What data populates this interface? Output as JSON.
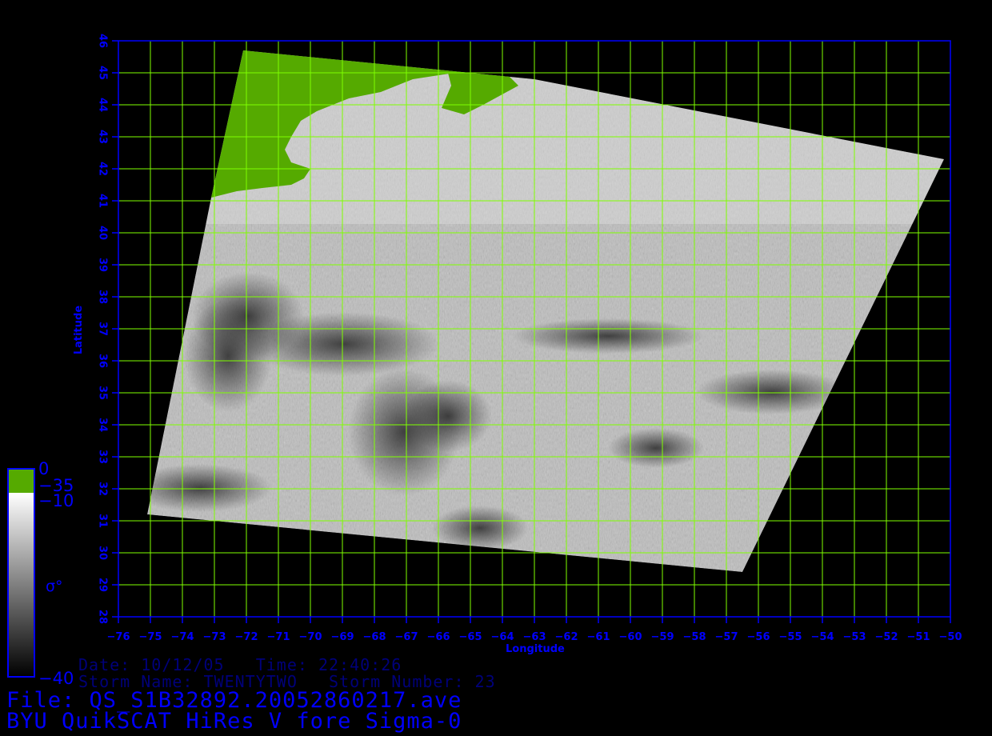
{
  "map": {
    "lon_min": -76,
    "lon_max": -50,
    "lon_step": 1,
    "lat_min": 28,
    "lat_max": 46,
    "lat_step": 1,
    "xlabel": "Longitude",
    "ylabel": "Latitude",
    "grid_color": "#7fff00",
    "axis_color": "#0000ff",
    "land_color": "#55aa00",
    "swath_corners": [
      [
        -72.1,
        45.7
      ],
      [
        -63,
        44.8
      ],
      [
        -50.2,
        42.3
      ],
      [
        -56.5,
        29.4
      ],
      [
        -75.1,
        31.2
      ],
      [
        -73.1,
        41.1
      ]
    ]
  },
  "colorbar": {
    "labels": {
      "top": "0",
      "land_break": "−35",
      "sea_top": "−10",
      "symbol": "σ°",
      "bottom": "−40"
    },
    "land_color": "#55aa00"
  },
  "meta": {
    "line1": "Date: 10/12/05   Time: 22:40:26",
    "line2": "Storm Name: TWENTYTWO   Storm Number: 23"
  },
  "footer": {
    "line1": "File: QS_S1B32892.20052860217.ave",
    "line2": "BYU QuikSCAT HiRes V fore Sigma-0"
  }
}
